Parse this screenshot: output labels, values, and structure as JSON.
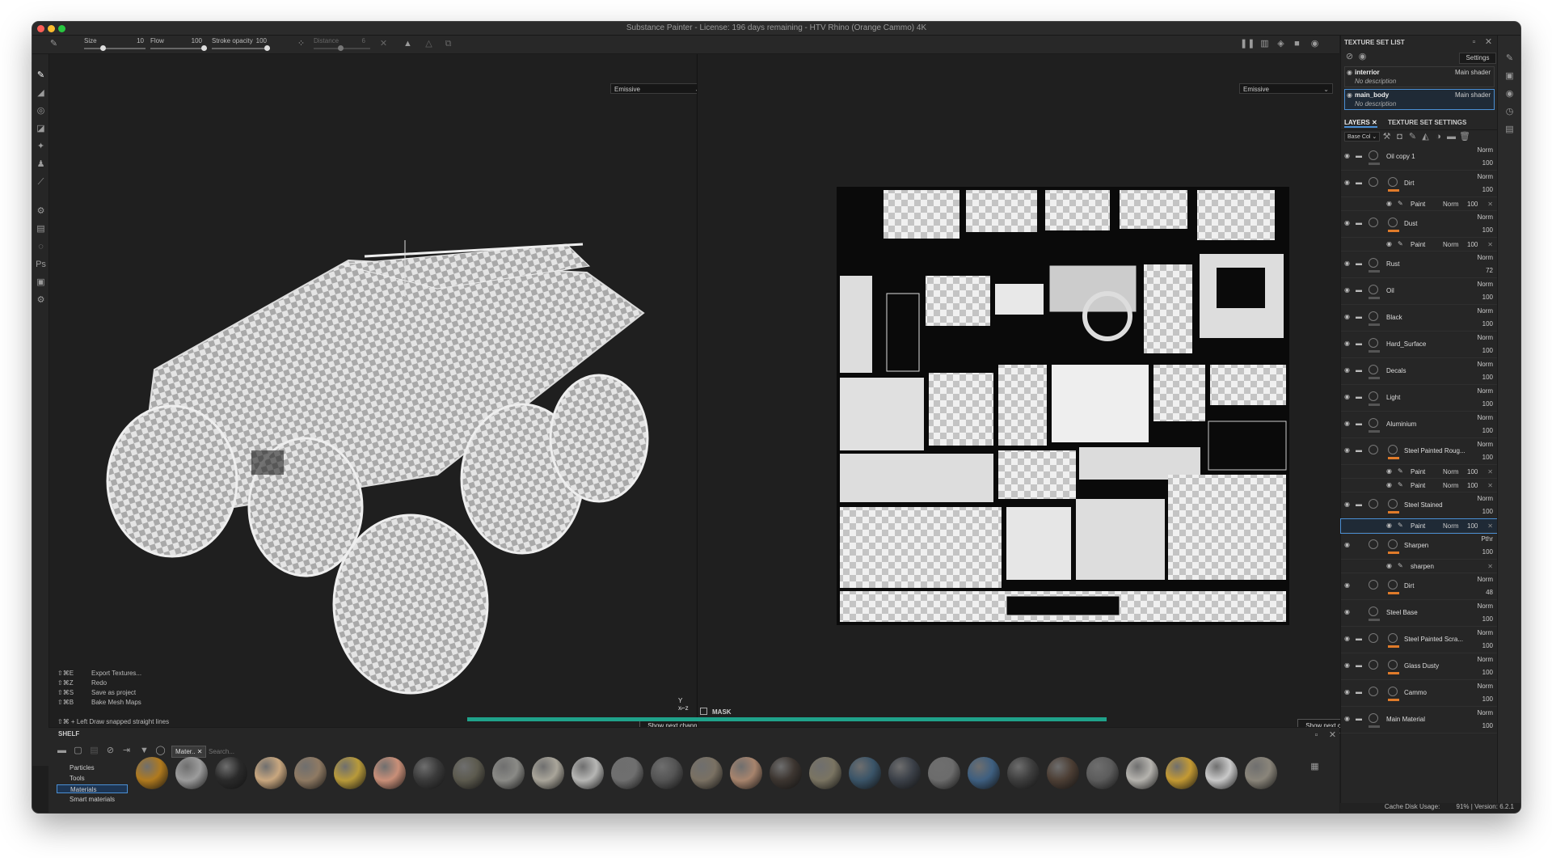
{
  "window": {
    "title": "Substance Painter - License: 196 days remaining - HTV Rhino (Orange Cammo) 4K"
  },
  "toolbar": {
    "size_label": "Size",
    "size_value": "10",
    "flow_label": "Flow",
    "flow_value": "100",
    "stroke_label": "Stroke opacity",
    "stroke_value": "100",
    "distance_label": "Distance",
    "distance_value": "6"
  },
  "viewport_3d": {
    "channel": "Emissive",
    "show_next": "Show next channel"
  },
  "viewport_2d": {
    "channel": "Emissive",
    "show_next": "Show next channel"
  },
  "shortcuts": [
    {
      "key": "⇧⌘E",
      "label": "Export Textures..."
    },
    {
      "key": "⇧⌘Z",
      "label": "Redo"
    },
    {
      "key": "⇧⌘S",
      "label": "Save as project"
    },
    {
      "key": "⇧⌘B",
      "label": "Bake Mesh Maps"
    }
  ],
  "hint": "⇧⌘ + Left  Draw snapped straight lines",
  "mask_label": "MASK",
  "shelf": {
    "title": "SHELF",
    "filter_tag": "Mater..",
    "search_placeholder": "Search...",
    "categories": [
      "Particles",
      "Tools",
      "Materials",
      "Smart materials"
    ],
    "selected_category": "Materials",
    "material_colors": [
      "#b07a1e",
      "#9c9c9c",
      "#2a2a2a",
      "#c9a77f",
      "#8f7a63",
      "#b89a3a",
      "#c98f78",
      "#3a3a3a",
      "#5c5a4e",
      "#8a8a86",
      "#a9a59a",
      "#b6b6b4",
      "#6f6f6f",
      "#545454",
      "#7a7163",
      "#a7846d",
      "#3c3530",
      "#7a7462",
      "#3a5468",
      "#3b4048",
      "#6c6c6c",
      "#3e5f80",
      "#3d3d3d",
      "#4c3e34",
      "#5c5c5c",
      "#b5b3ae",
      "#c49a33",
      "#c9c9c9",
      "#8a857a"
    ]
  },
  "texture_set_list": {
    "title": "TEXTURE SET LIST",
    "settings": "Settings",
    "sets": [
      {
        "name": "interrior",
        "shader": "Main shader",
        "description": "No description"
      },
      {
        "name": "main_body",
        "shader": "Main shader",
        "description": "No description"
      }
    ]
  },
  "layers_panel": {
    "tab_layers": "LAYERS",
    "tab_settings": "TEXTURE SET SETTINGS",
    "channel": "Base Col",
    "layers": [
      {
        "name": "Oil copy 1",
        "blend": "Norm",
        "opacity": "100",
        "type": "folder"
      },
      {
        "name": "Dirt",
        "blend": "Norm",
        "opacity": "100",
        "type": "folder",
        "orange": true
      },
      {
        "name": "Paint",
        "blend": "Norm",
        "opacity": "100",
        "type": "sub"
      },
      {
        "name": "Dust",
        "blend": "Norm",
        "opacity": "100",
        "type": "folder",
        "orange": true
      },
      {
        "name": "Paint",
        "blend": "Norm",
        "opacity": "100",
        "type": "sub"
      },
      {
        "name": "Rust",
        "blend": "Norm",
        "opacity": "72",
        "type": "folder"
      },
      {
        "name": "Oil",
        "blend": "Norm",
        "opacity": "100",
        "type": "folder"
      },
      {
        "name": "Black",
        "blend": "Norm",
        "opacity": "100",
        "type": "folder"
      },
      {
        "name": "Hard_Surface",
        "blend": "Norm",
        "opacity": "100",
        "type": "folder"
      },
      {
        "name": "Decals",
        "blend": "Norm",
        "opacity": "100",
        "type": "folder"
      },
      {
        "name": "Light",
        "blend": "Norm",
        "opacity": "100",
        "type": "folder"
      },
      {
        "name": "Aluminium",
        "blend": "Norm",
        "opacity": "100",
        "type": "folder"
      },
      {
        "name": "Steel Painted Roug...",
        "blend": "Norm",
        "opacity": "100",
        "type": "folder",
        "orange": true
      },
      {
        "name": "Paint",
        "blend": "Norm",
        "opacity": "100",
        "type": "sub"
      },
      {
        "name": "Paint",
        "blend": "Norm",
        "opacity": "100",
        "type": "sub"
      },
      {
        "name": "Steel Stained",
        "blend": "Norm",
        "opacity": "100",
        "type": "folder",
        "orange": true
      },
      {
        "name": "Paint",
        "blend": "Norm",
        "opacity": "100",
        "type": "sub",
        "selected": true
      },
      {
        "name": "Sharpen",
        "blend": "Pthr",
        "opacity": "100",
        "type": "layer",
        "orange": true
      },
      {
        "name": "sharpen",
        "blend": "",
        "opacity": "",
        "type": "sub"
      },
      {
        "name": "Dirt",
        "blend": "Norm",
        "opacity": "48",
        "type": "layer",
        "orange": true
      },
      {
        "name": "Steel Base",
        "blend": "Norm",
        "opacity": "100",
        "type": "layer"
      },
      {
        "name": "Steel Painted Scra...",
        "blend": "Norm",
        "opacity": "100",
        "type": "folder",
        "orange": true
      },
      {
        "name": "Glass Dusty",
        "blend": "Norm",
        "opacity": "100",
        "type": "folder",
        "orange": true
      },
      {
        "name": "Cammo",
        "blend": "Norm",
        "opacity": "100",
        "type": "folder",
        "orange": true
      },
      {
        "name": "Main Material",
        "blend": "Norm",
        "opacity": "100",
        "type": "folder"
      }
    ]
  },
  "status": {
    "cache": "Cache Disk Usage:",
    "usage": "91% | Version: 6.2.1"
  }
}
